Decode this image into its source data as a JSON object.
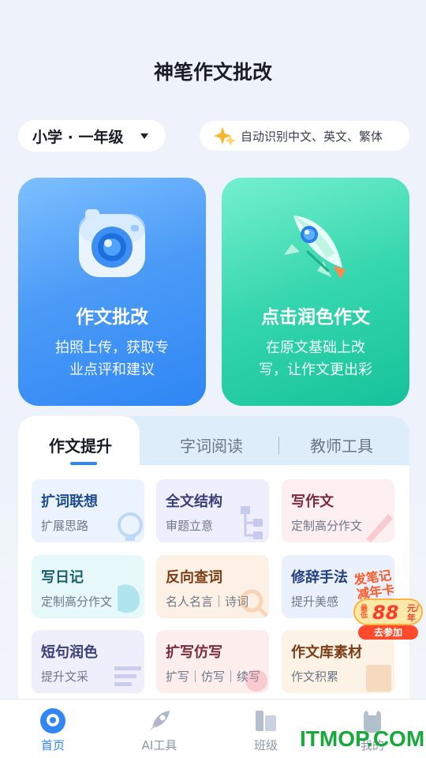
{
  "header": {
    "title": "神笔作文批改"
  },
  "grade_selector": {
    "label": "小学 · 一年级",
    "icon": "caret-down-icon"
  },
  "lang_pill": {
    "label": "自动识别中文、英文、繁体",
    "icon": "sparkle-icon"
  },
  "cards": [
    {
      "title": "作文批改",
      "desc_line1": "拍照上传，获取专",
      "desc_line2": "业点评和建议",
      "icon": "camera-icon",
      "color": "#3d91f6"
    },
    {
      "title": "点击润色作文",
      "desc_line1": "在原文基础上改",
      "desc_line2": "写，让作文更出彩",
      "icon": "rocket-icon",
      "color": "#2ccfa6"
    }
  ],
  "tabs": [
    {
      "label": "作文提升",
      "active": true
    },
    {
      "label": "字词阅读",
      "active": false
    },
    {
      "label": "教师工具",
      "active": false
    }
  ],
  "tools": [
    {
      "name": "扩词联想",
      "sub": "扩展思路"
    },
    {
      "name": "全文结构",
      "sub": "审题立意"
    },
    {
      "name": "写作文",
      "sub": "定制高分作文"
    },
    {
      "name": "写日记",
      "sub": "定制高分作文"
    },
    {
      "name": "反向查词",
      "sub": "名人名言｜诗词"
    },
    {
      "name": "修辞手法",
      "sub": "提升美感"
    },
    {
      "name": "短句润色",
      "sub": "提升文采"
    },
    {
      "name": "扩写仿写",
      "sub": "扩写｜仿写｜续写"
    },
    {
      "name": "作文库素材",
      "sub": "作文积累"
    }
  ],
  "promo": {
    "line1": "发笔记",
    "line2": "减年卡",
    "tag": "最低",
    "price": "88",
    "unit": "元/年",
    "cta": "去参加"
  },
  "bottom_nav": [
    {
      "label": "首页",
      "icon": "home-icon",
      "active": true
    },
    {
      "label": "AI工具",
      "icon": "rocket-icon",
      "active": false
    },
    {
      "label": "班级",
      "icon": "class-icon",
      "active": false
    },
    {
      "label": "我的",
      "icon": "profile-icon",
      "active": false
    }
  ],
  "watermark": {
    "text": "ITMOP.COM"
  },
  "colors": {
    "accent": "#2f86f4",
    "green": "#2ccfa6",
    "promo": "#ff4b2b"
  }
}
